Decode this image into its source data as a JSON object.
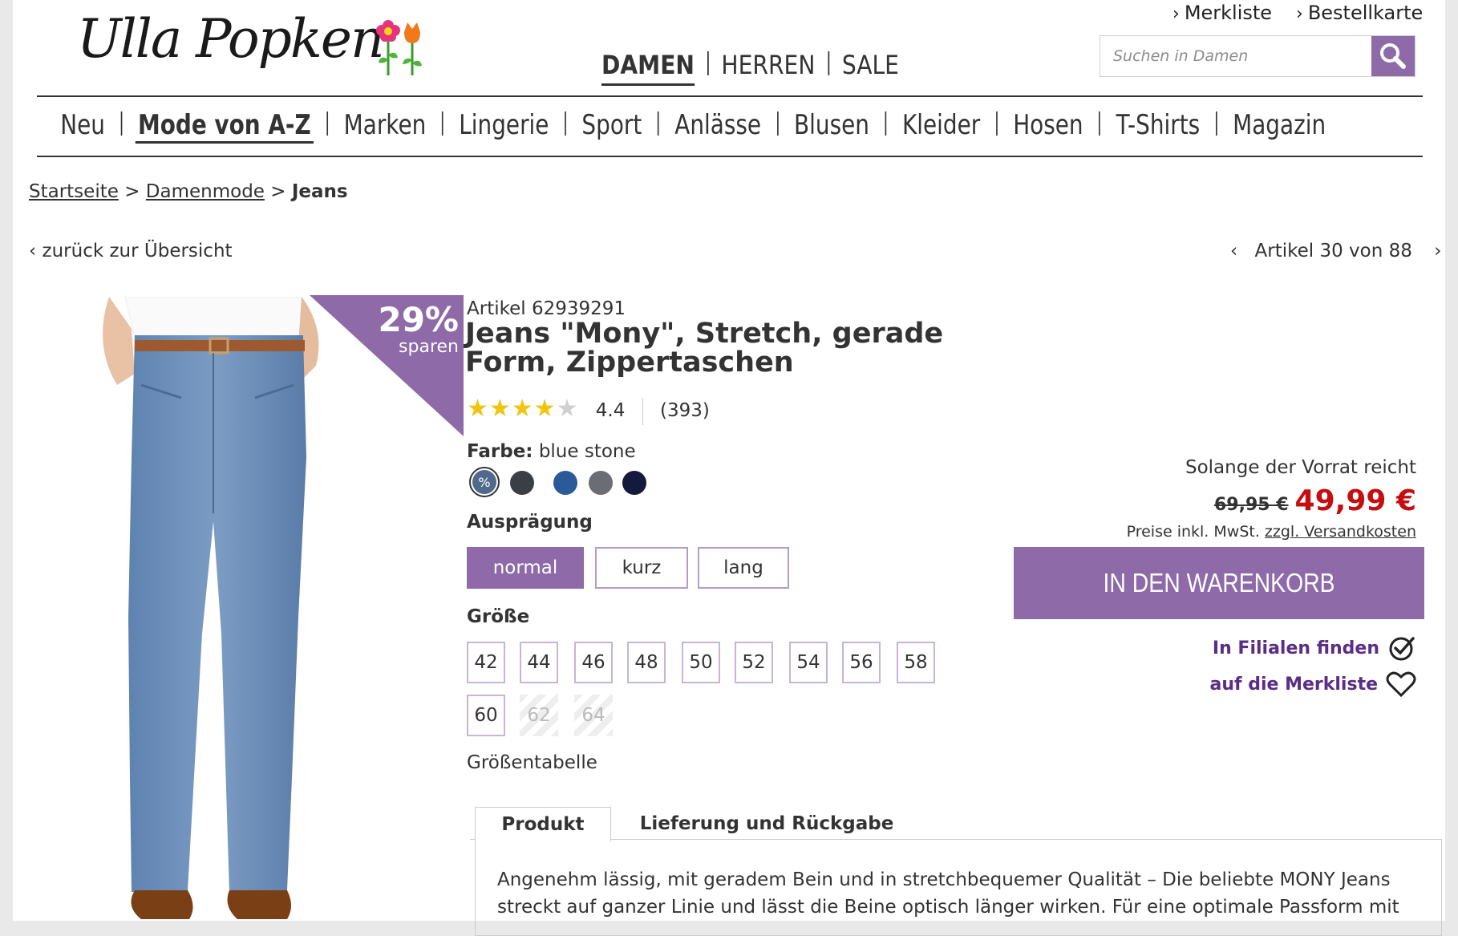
{
  "brand": {
    "logo_text": "Ulla Popken"
  },
  "utility": {
    "wishlist": "Merkliste",
    "order_card": "Bestellkarte"
  },
  "gender_nav": [
    "DAMEN",
    "HERREN",
    "SALE"
  ],
  "search": {
    "placeholder": "Suchen in Damen"
  },
  "category_nav": [
    "Neu",
    "Mode von A-Z",
    "Marken",
    "Lingerie",
    "Sport",
    "Anlässe",
    "Blusen",
    "Kleider",
    "Hosen",
    "T-Shirts",
    "Magazin"
  ],
  "breadcrumb": {
    "home": "Startseite",
    "sep": ">",
    "section": "Damenmode",
    "current": "Jeans"
  },
  "nav": {
    "back": "zurück zur Übersicht",
    "pager": "Artikel 30 von 88"
  },
  "badge": {
    "percent": "29%",
    "text": "sparen"
  },
  "product": {
    "article": "Artikel 62939291",
    "title": "Jeans \"Mony\", Stretch, gerade Form, Zippertaschen",
    "rating_value": "4.4",
    "rating_stars": 4.4,
    "review_count": "(393)",
    "color_label": "Farbe:",
    "color_value": "blue stone",
    "swatches": [
      "#4f6a8a",
      "#3a3f45",
      "#2b5a9a",
      "#6a6d73",
      "#141a3c"
    ],
    "swatch_sale_mark": "%",
    "variant_label": "Ausprägung",
    "variants": [
      "normal",
      "kurz",
      "lang"
    ],
    "selected_variant": "normal",
    "size_label": "Größe",
    "sizes": [
      "42",
      "44",
      "46",
      "48",
      "50",
      "52",
      "54",
      "56",
      "58",
      "60",
      "62",
      "64"
    ],
    "unavailable_sizes": [
      "62",
      "64"
    ],
    "size_table": "Größentabelle"
  },
  "pricing": {
    "stock_note": "Solange der Vorrat reicht",
    "old_price": "69,95 €",
    "new_price": "49,99 €",
    "vat_prefix": "Preise inkl. MwSt.",
    "shipping_link": "zzgl. Versandkosten",
    "cart_button": "IN DEN WARENKORB",
    "find_store": "In Filialen finden",
    "add_wishlist": "auf die Merkliste"
  },
  "tabs": {
    "product": "Produkt",
    "shipping": "Lieferung und Rückgabe"
  },
  "description": "Angenehm lässig, mit geradem Bein und in stretchbequemer Qualität – Die beliebte MONY Jeans streckt auf ganzer Linie und lässt die Beine optisch länger wirken. Für eine optimale Passform mit",
  "colors": {
    "accent": "#8e6aa8",
    "price_red": "#c50e10",
    "link_purple": "#5b2d86",
    "star": "#f2c40f"
  }
}
